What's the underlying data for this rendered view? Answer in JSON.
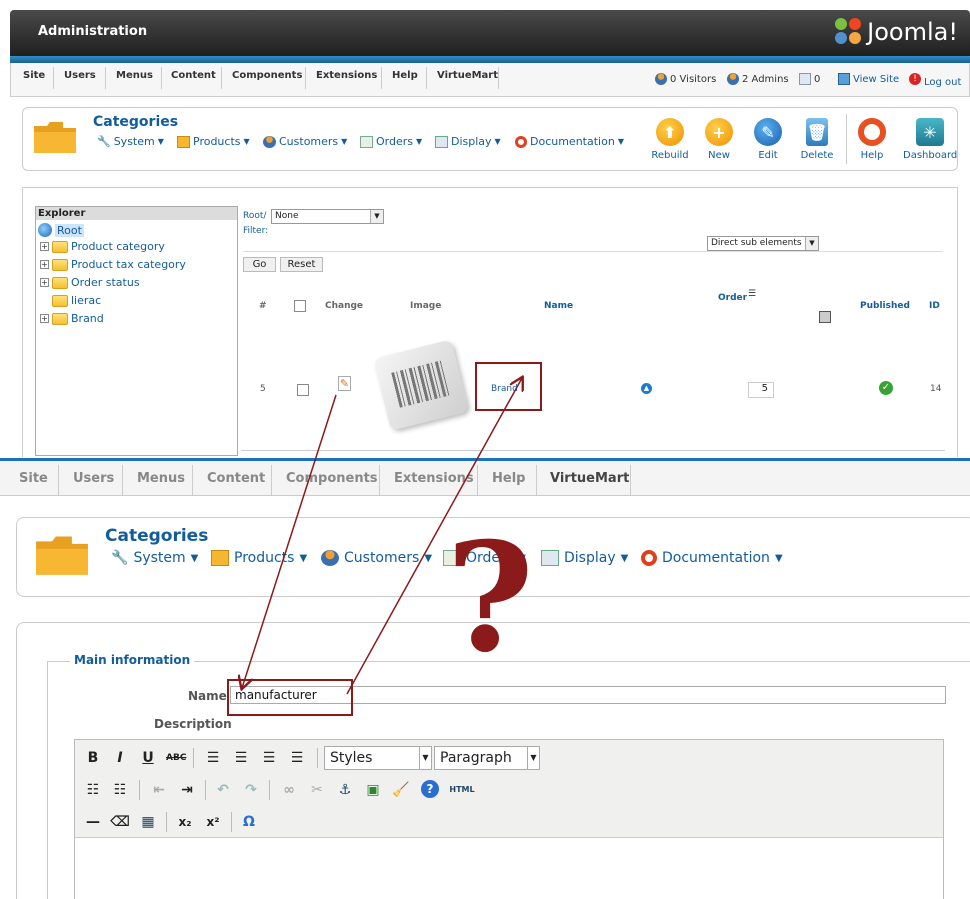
{
  "header": {
    "title": "Administration",
    "logo_text": "Joomla!"
  },
  "top_menu": {
    "items": [
      "Site",
      "Users",
      "Menus",
      "Content",
      "Components",
      "Extensions",
      "Help",
      "VirtueMart"
    ],
    "status": {
      "visitors": "0 Visitors",
      "admins": "2 Admins",
      "messages": "0",
      "view_site": "View Site",
      "logout": "Log out"
    }
  },
  "toolbar": {
    "title": "Categories",
    "submenus": [
      "System",
      "Products",
      "Customers",
      "Orders",
      "Display",
      "Documentation"
    ],
    "buttons": [
      "Rebuild",
      "New",
      "Edit",
      "Delete",
      "Help",
      "Dashboard"
    ]
  },
  "explorer": {
    "header": "Explorer",
    "root": "Root",
    "items": [
      "Product category",
      "Product tax category",
      "Order status",
      "lierac",
      "Brand"
    ]
  },
  "filters": {
    "root_label": "Root/",
    "root_value": "None",
    "filter_label": "Filter:",
    "scope_value": "Direct sub elements",
    "go": "Go",
    "reset": "Reset"
  },
  "table": {
    "headers": [
      "#",
      "Change",
      "Image",
      "Name",
      "Order",
      "Published",
      "ID"
    ],
    "row": {
      "num": "5",
      "name": "Brand",
      "order": "5",
      "id": "14"
    }
  },
  "zoomed_menu": {
    "items": [
      "Site",
      "Users",
      "Menus",
      "Content",
      "Components",
      "Extensions",
      "Help",
      "VirtueMart"
    ],
    "active": "VirtueMart"
  },
  "zoomed_toolbar": {
    "title": "Categories",
    "submenus": [
      "System",
      "Products",
      "Customers",
      "Orders",
      "Display",
      "Documentation"
    ]
  },
  "form": {
    "legend": "Main information",
    "name_label": "Name",
    "name_value": "manufacturer",
    "description_label": "Description",
    "styles_value": "Styles",
    "paragraph_value": "Paragraph",
    "html_button": "HTML"
  },
  "annotation": {
    "question_mark": "?"
  },
  "colors": {
    "link_blue": "#135c9c",
    "annotation_red": "#8b1a1a",
    "header_dark": "#2a2a2a"
  }
}
